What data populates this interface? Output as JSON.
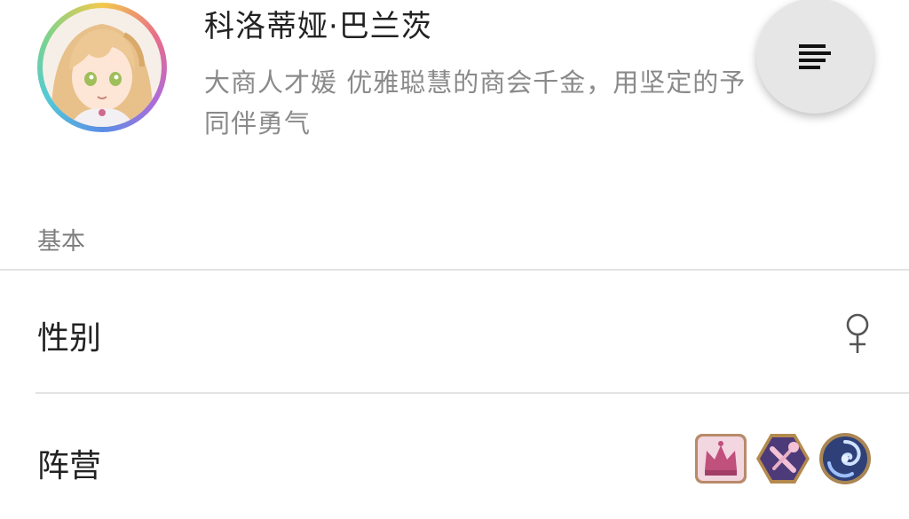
{
  "profile": {
    "name": "科洛蒂娅·巴兰茨",
    "description": "大商人才媛 优雅聪慧的商会千金，用坚定的予同伴勇气",
    "avatar": "character-portrait"
  },
  "menu_button": {
    "icon": "menu-lines-icon"
  },
  "section": {
    "title": "基本"
  },
  "rows": {
    "gender": {
      "label": "性别",
      "value_icon": "female-symbol-icon"
    },
    "faction": {
      "label": "阵营",
      "icons": [
        "crown-faction-icon",
        "tools-faction-icon",
        "vortex-faction-icon"
      ]
    }
  },
  "colors": {
    "text_primary": "#222222",
    "text_secondary": "#8a8a8a",
    "divider": "#e3e3e3",
    "fab_background": "#e6e6e6"
  }
}
